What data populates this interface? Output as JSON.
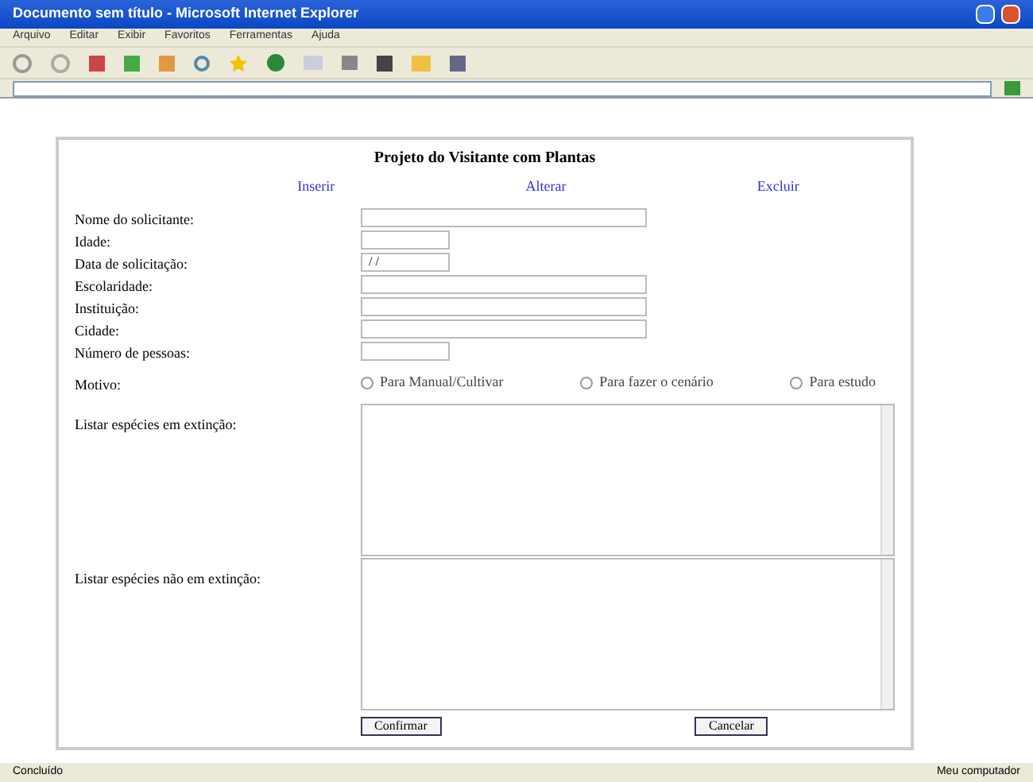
{
  "window": {
    "title": "Documento sem título - Microsoft Internet Explorer"
  },
  "menu": [
    "Arquivo",
    "Editar",
    "Exibir",
    "Favoritos",
    "Ferramentas",
    "Ajuda"
  ],
  "form": {
    "title": "Projeto do Visitante com Plantas",
    "links": [
      "Inserir",
      "Alterar",
      "Excluir"
    ],
    "fields": [
      {
        "label": "Nome do solicitante:",
        "kind": "long"
      },
      {
        "label": "Idade:",
        "kind": "short"
      },
      {
        "label": "Data de solicitação:",
        "kind": "short",
        "value": "/ /"
      },
      {
        "label": "Escolaridade:",
        "kind": "long"
      },
      {
        "label": "Instituição:",
        "kind": "long"
      },
      {
        "label": "Cidade:",
        "kind": "long"
      },
      {
        "label": "Número de pessoas:",
        "kind": "short"
      },
      {
        "label": "Motivo:",
        "kind": "radio",
        "options": [
          {
            "label": "Para Manual/Cultivar",
            "selected": false
          },
          {
            "label": "Para fazer o cenário",
            "selected": false
          },
          {
            "label": "Para estudo",
            "selected": false
          }
        ]
      },
      {
        "label": "Listar espécies em extinção:",
        "kind": "area"
      },
      {
        "label": "Listar espécies não em extinção:",
        "kind": "area"
      }
    ],
    "buttons": [
      "Confirmar",
      "Cancelar"
    ]
  },
  "status_bar": {
    "left": "Concluído",
    "right": "Meu computador"
  }
}
